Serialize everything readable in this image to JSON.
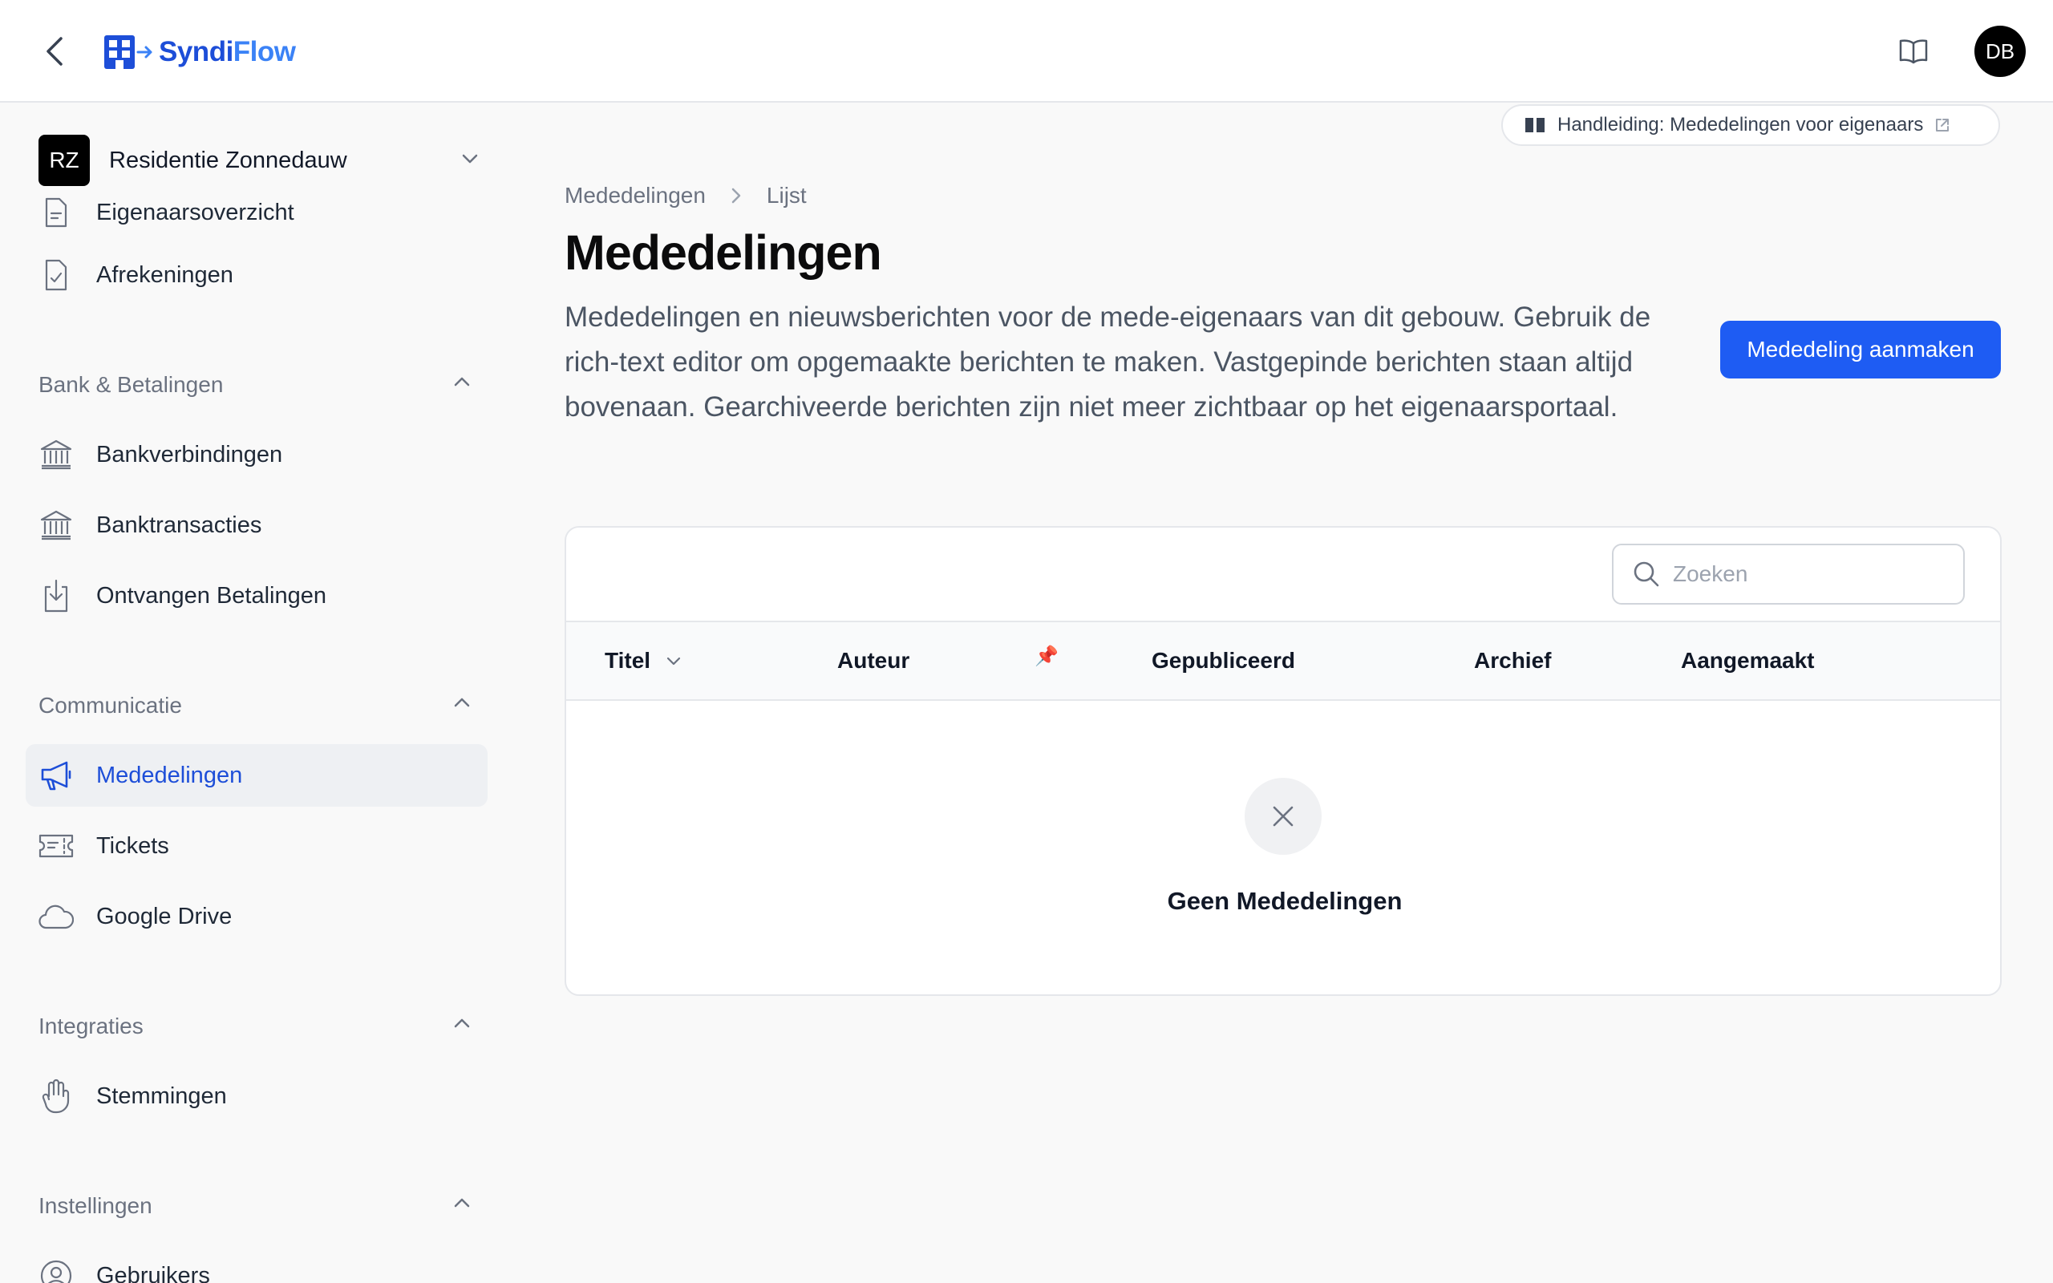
{
  "app": {
    "brand_part1": "Syndi",
    "brand_part2": "Flow"
  },
  "user": {
    "initials": "DB"
  },
  "tenant": {
    "initials": "RZ",
    "name": "Residentie Zonnedauw"
  },
  "sidebar": {
    "top_items": [
      {
        "label": "Eigenaarsoverzicht",
        "icon": "document-list-icon"
      },
      {
        "label": "Afrekeningen",
        "icon": "document-check-icon"
      }
    ],
    "groups": [
      {
        "label": "Bank & Betalingen",
        "items": [
          {
            "label": "Bankverbindingen",
            "icon": "bank-icon"
          },
          {
            "label": "Banktransacties",
            "icon": "bank-icon"
          },
          {
            "label": "Ontvangen Betalingen",
            "icon": "download-document-icon"
          }
        ]
      },
      {
        "label": "Communicatie",
        "items": [
          {
            "label": "Mededelingen",
            "icon": "megaphone-icon",
            "active": true
          },
          {
            "label": "Tickets",
            "icon": "ticket-icon"
          },
          {
            "label": "Google Drive",
            "icon": "cloud-icon"
          }
        ]
      },
      {
        "label": "Integraties",
        "items": [
          {
            "label": "Stemmingen",
            "icon": "hand-icon"
          }
        ]
      },
      {
        "label": "Instellingen",
        "items": [
          {
            "label": "Gebruikers",
            "icon": "user-circle-icon"
          }
        ]
      }
    ]
  },
  "guide": {
    "label": "Handleiding: Mededelingen voor eigenaars"
  },
  "breadcrumb": {
    "parent": "Mededelingen",
    "current": "Lijst"
  },
  "page": {
    "title": "Mededelingen",
    "description": "Mededelingen en nieuwsberichten voor de mede-eigenaars van dit gebouw. Gebruik de rich-text editor om opgemaakte berichten te maken. Vastgepinde berichten staan altijd bovenaan. Gearchiveerde berichten zijn niet meer zichtbaar op het eigenaarsportaal.",
    "create_button": "Mededeling aanmaken"
  },
  "table": {
    "search_placeholder": "Zoeken",
    "columns": [
      "Titel",
      "Auteur",
      "📌",
      "Gepubliceerd",
      "Archief",
      "Aangemaakt"
    ],
    "empty_text": "Geen Mededelingen"
  },
  "colors": {
    "accent": "#1e5cf3",
    "active_nav_text": "#1d4ed8"
  }
}
